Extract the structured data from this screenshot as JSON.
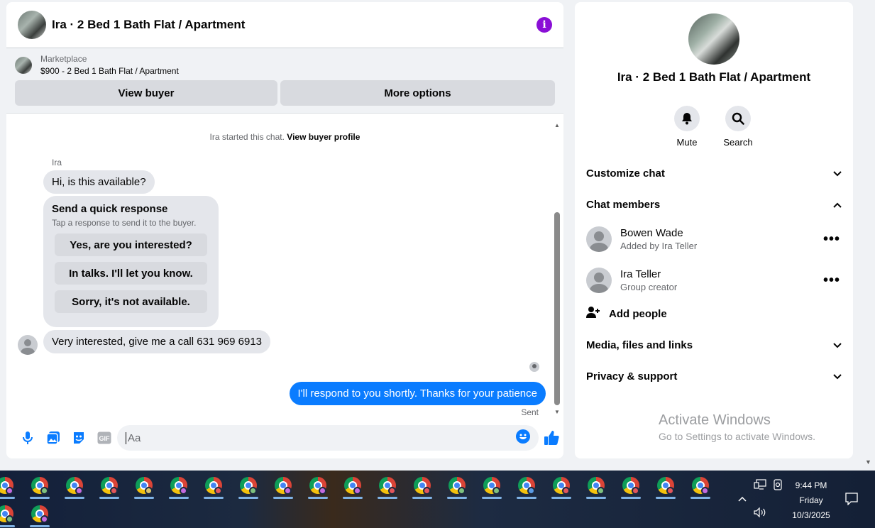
{
  "chat": {
    "title": "Ira · 2 Bed 1 Bath Flat / Apartment",
    "marketplace_label": "Marketplace",
    "listing": "$900 - 2 Bed 1 Bath Flat / Apartment",
    "view_buyer": "View buyer",
    "more_options": "More options"
  },
  "messages": {
    "system_prefix": "Ira started this chat.",
    "system_link": "View buyer profile",
    "sender": "Ira",
    "first": "Hi, is this available?",
    "quick_title": "Send a quick response",
    "quick_sub": "Tap a response to send it to the buyer.",
    "quick_options": [
      "Yes, are you interested?",
      "In talks. I'll let you know.",
      "Sorry, it's not available."
    ],
    "second": "Very interested, give me a call 631 969 6913",
    "own": "I'll respond to you shortly. Thanks for your patience",
    "status": "Sent"
  },
  "composer": {
    "placeholder": "Aa",
    "icons": [
      "microphone-icon",
      "photo-icon",
      "sticker-icon",
      "gif-icon",
      "emoji-icon",
      "thumbs-up-icon"
    ],
    "gif_label": "GIF"
  },
  "info": {
    "title": "Ira · 2 Bed 1 Bath Flat / Apartment",
    "mute": "Mute",
    "search": "Search",
    "customize": "Customize chat",
    "members_header": "Chat members",
    "members": [
      {
        "name": "Bowen Wade",
        "sub": "Added by Ira Teller"
      },
      {
        "name": "Ira Teller",
        "sub": "Group creator"
      }
    ],
    "add_people": "Add people",
    "media": "Media, files and links",
    "privacy": "Privacy & support"
  },
  "watermark": {
    "title": "Activate Windows",
    "sub": "Go to Settings to activate Windows."
  },
  "taskbar": {
    "time": "9:44 PM",
    "day": "Friday",
    "date": "10/3/2025",
    "app": "chrome-icon",
    "badge_colors": [
      "#c56be0",
      "#7fc27f",
      "#c56be0",
      "#e2565b",
      "#d9c36b",
      "#c56be0",
      "#e2565b",
      "#7fc27f",
      "#c56be0",
      "#c56be0",
      "#c56be0",
      "#e2565b",
      "#e2565b",
      "#7fc27f",
      "#7fc27f",
      "#5a9be5",
      "#e2565b",
      "#7fc27f",
      "#e2565b",
      "#e2565b",
      "#c56be0",
      "#7fc27f",
      "#c56be0"
    ]
  },
  "colors": {
    "accent_blue": "#0a7cff",
    "info_purple": "#8a0fd6"
  }
}
